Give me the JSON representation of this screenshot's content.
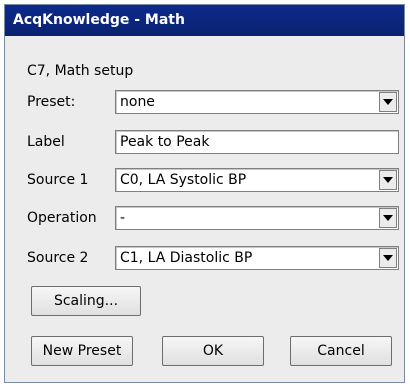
{
  "window": {
    "title": "AcqKnowledge - Math"
  },
  "heading": "C7, Math setup",
  "form": {
    "preset": {
      "label": "Preset:",
      "value": "none"
    },
    "label": {
      "label": "Label",
      "value": "Peak to Peak"
    },
    "source1": {
      "label": "Source 1",
      "value": "C0, LA Systolic BP"
    },
    "operation": {
      "label": "Operation",
      "value": "-"
    },
    "source2": {
      "label": "Source 2",
      "value": "C1, LA Diastolic BP"
    }
  },
  "buttons": {
    "scaling": "Scaling...",
    "new_preset": "New Preset",
    "ok": "OK",
    "cancel": "Cancel"
  }
}
